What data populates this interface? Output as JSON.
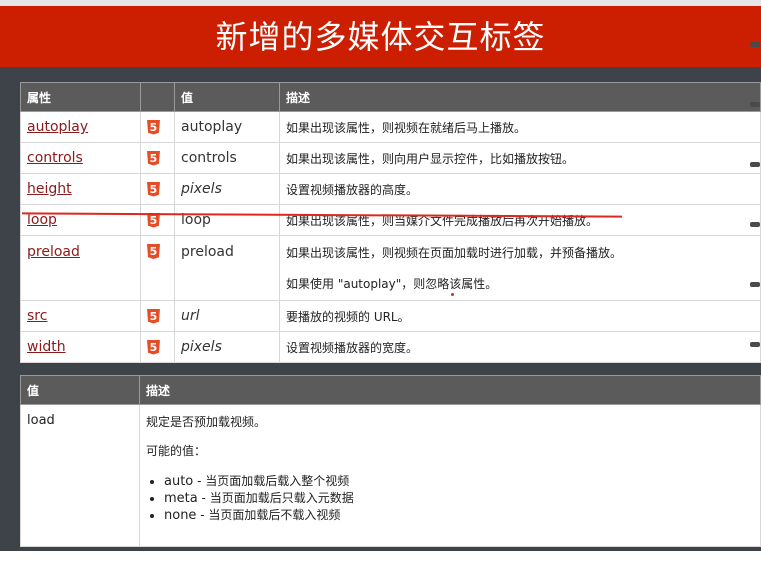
{
  "header": {
    "title": "新增的多媒体交互标签"
  },
  "table1": {
    "headers": [
      "属性",
      "值",
      "描述"
    ],
    "rows": [
      {
        "attr": "autoplay",
        "value": "autoplay",
        "desc": "如果出现该属性，则视频在就绪后马上播放。"
      },
      {
        "attr": "controls",
        "value": "controls",
        "desc": "如果出现该属性，则向用户显示控件，比如播放按钮。"
      },
      {
        "attr": "height",
        "value": "pixels",
        "desc": "设置视频播放器的高度。"
      },
      {
        "attr": "loop",
        "value": "loop",
        "desc": "如果出现该属性，则当媒介文件完成播放后再次开始播放。"
      },
      {
        "attr": "preload",
        "value": "preload",
        "desc": "如果出现该属性，则视频在页面加载时进行加载，并预备播放。",
        "desc2": "如果使用 \"autoplay\"，则忽略该属性。"
      },
      {
        "attr": "src",
        "value": "url",
        "desc": "要播放的视频的 URL。"
      },
      {
        "attr": "width",
        "value": "pixels",
        "desc": "设置视频播放器的宽度。"
      }
    ],
    "badge": "5"
  },
  "table2": {
    "headers": [
      "值",
      "描述"
    ],
    "value": "load",
    "line1": "规定是否预加载视频。",
    "line2": "可能的值：",
    "items": [
      {
        "key": "auto",
        "text": " - 当页面加载后载入整个视频"
      },
      {
        "key": "meta",
        "text": " - 当页面加载后只载入元数据"
      },
      {
        "key": "none",
        "text": " - 当页面加载后不载入视频"
      }
    ]
  },
  "colors": {
    "header_red": "#cc1e00",
    "slide_dark": "#3d4348",
    "link": "#8b1a1a",
    "html5_badge": "#e44d26",
    "annotation_red": "#e0271f"
  }
}
